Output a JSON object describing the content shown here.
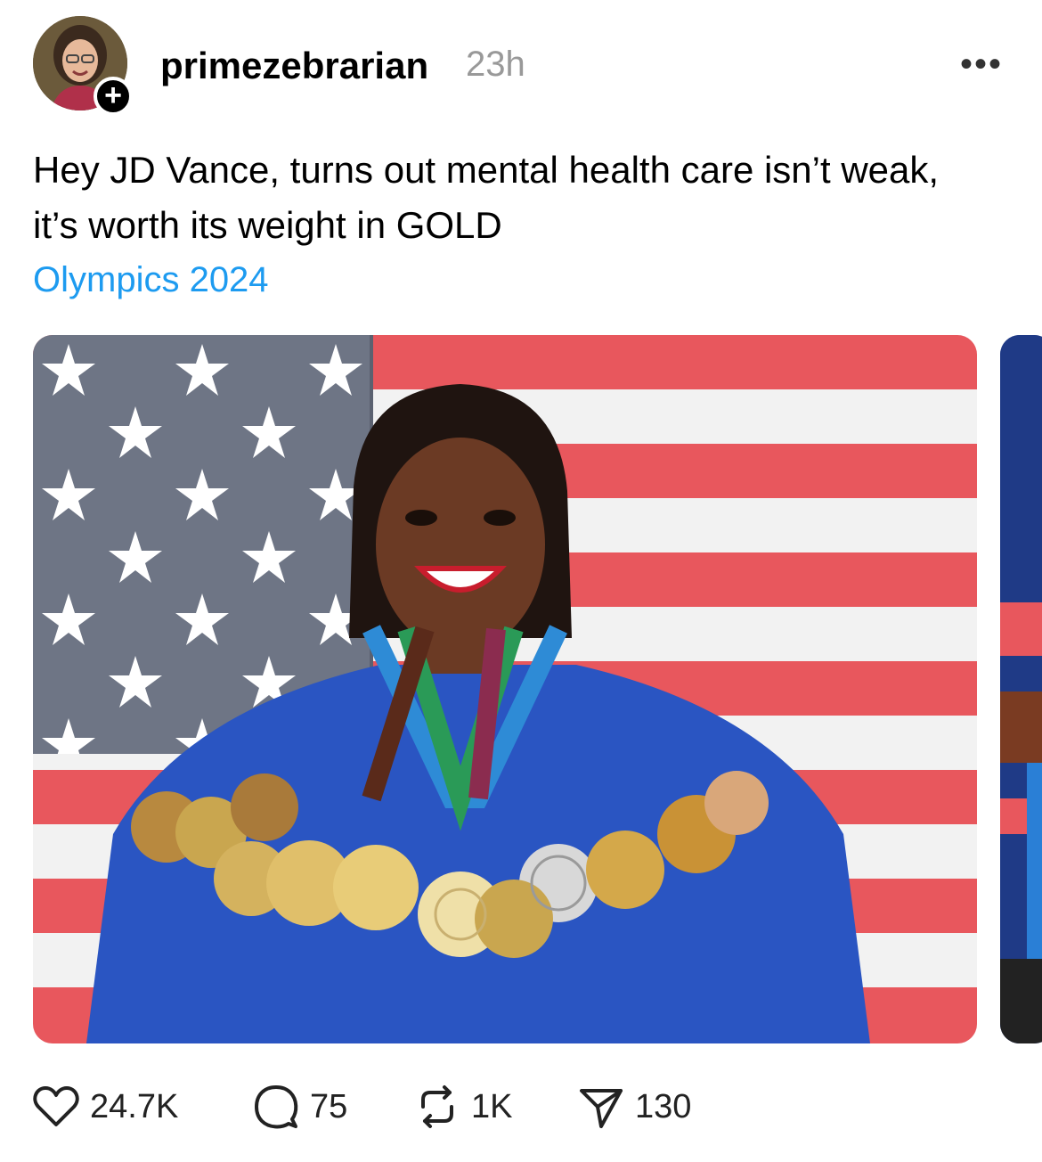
{
  "post": {
    "author": {
      "username": "primezebrarian",
      "time": "23h",
      "follow_icon": "plus-icon"
    },
    "more_icon": "more-icon",
    "text": "Hey JD Vance, turns out mental health care isn’t weak, it’s worth its weight in GOLD",
    "topic_tag": "Olympics 2024",
    "accent_color": "#1d9bf0",
    "actions": {
      "likes": "24.7K",
      "replies": "75",
      "reposts": "1K",
      "shares": "130"
    },
    "media": [
      {
        "icon": "photo"
      },
      {
        "icon": "photo"
      }
    ]
  }
}
